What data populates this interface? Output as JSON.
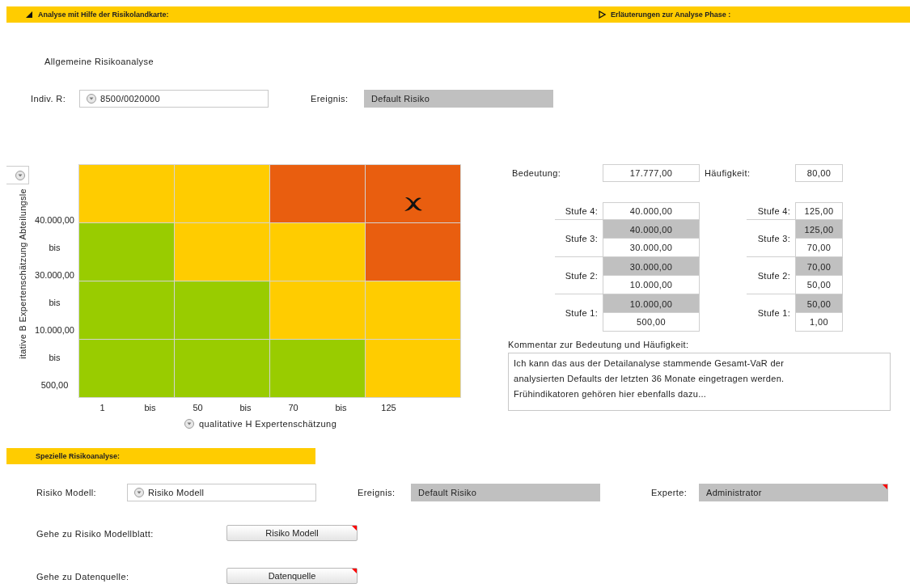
{
  "header": {
    "title": "Analyse mit Hilfe der Risikolandkarte:",
    "expanded": true,
    "explanation": {
      "label": "Erläuterungen zur Analyse Phase :",
      "expanded": false
    }
  },
  "general": {
    "title": "Allgemeine Risikoanalyse",
    "indiv_label": "Indiv. R:",
    "indiv_value": "8500/0020000",
    "event_label": "Ereignis:",
    "event_value": "Default Risiko"
  },
  "matrix": {
    "y_axis_title": "itative B Expertenschätzung Abteilungsle",
    "y_labels": [
      "40.000,00",
      "bis",
      "30.000,00",
      "bis",
      "10.000,00",
      "bis",
      "500,00"
    ],
    "x_labels": [
      "1",
      "bis",
      "50",
      "bis",
      "70",
      "bis",
      "125"
    ],
    "x_axis_title": "qualitative H Expertenschätzung",
    "rows": [
      [
        {
          "color": "#ffcc00",
          "marked": false
        },
        {
          "color": "#ffcc00",
          "marked": false
        },
        {
          "color": "#e95e0f",
          "marked": false
        },
        {
          "color": "#e95e0f",
          "marked": true
        }
      ],
      [
        {
          "color": "#99cc00",
          "marked": false
        },
        {
          "color": "#ffcc00",
          "marked": false
        },
        {
          "color": "#ffcc00",
          "marked": false
        },
        {
          "color": "#e95e0f",
          "marked": false
        }
      ],
      [
        {
          "color": "#99cc00",
          "marked": false
        },
        {
          "color": "#99cc00",
          "marked": false
        },
        {
          "color": "#ffcc00",
          "marked": false
        },
        {
          "color": "#ffcc00",
          "marked": false
        }
      ],
      [
        {
          "color": "#99cc00",
          "marked": false
        },
        {
          "color": "#99cc00",
          "marked": false
        },
        {
          "color": "#99cc00",
          "marked": false
        },
        {
          "color": "#ffcc00",
          "marked": false
        }
      ]
    ]
  },
  "assessment": {
    "significance_label": "Bedeutung:",
    "significance_value": "17.777,00",
    "frequency_label": "Häufigkeit:",
    "frequency_value": "80,00",
    "significance_levels": [
      {
        "label": "Stufe 4:",
        "values": [
          {
            "text": "40.000,00",
            "shaded": false
          }
        ]
      },
      {
        "label": "Stufe 3:",
        "values": [
          {
            "text": "40.000,00",
            "shaded": true
          },
          {
            "text": "30.000,00",
            "shaded": false
          }
        ]
      },
      {
        "label": "Stufe 2:",
        "values": [
          {
            "text": "30.000,00",
            "shaded": true
          },
          {
            "text": "10.000,00",
            "shaded": false
          }
        ]
      },
      {
        "label": "Stufe 1:",
        "values": [
          {
            "text": "10.000,00",
            "shaded": true
          },
          {
            "text": "500,00",
            "shaded": false
          }
        ]
      }
    ],
    "frequency_levels": [
      {
        "label": "Stufe 4:",
        "values": [
          {
            "text": "125,00",
            "shaded": false
          }
        ]
      },
      {
        "label": "Stufe 3:",
        "values": [
          {
            "text": "125,00",
            "shaded": true
          },
          {
            "text": "70,00",
            "shaded": false
          }
        ]
      },
      {
        "label": "Stufe 2:",
        "values": [
          {
            "text": "70,00",
            "shaded": true
          },
          {
            "text": "50,00",
            "shaded": false
          }
        ]
      },
      {
        "label": "Stufe 1:",
        "values": [
          {
            "text": "50,00",
            "shaded": true
          },
          {
            "text": "1,00",
            "shaded": false
          }
        ]
      }
    ],
    "comment_label": "Kommentar zur Bedeutung und Häufigkeit:",
    "comment_lines": [
      "Ich kann das aus der Detailanalyse stammende Gesamt-VaR der",
      "analysierten Defaults der letzten 36 Monate eingetragen werden.",
      "Frühindikatoren gehören hier ebenfalls dazu..."
    ]
  },
  "special": {
    "title": "Spezielle Risikoanalyse:",
    "model_label": "Risiko Modell:",
    "model_value": "Risiko Modell",
    "event_label": "Ereignis:",
    "event_value": "Default Risiko",
    "expert_label": "Experte:",
    "expert_value": "Administrator",
    "expert_has_comment": true,
    "links": [
      {
        "label": "Gehe zu Risiko Modellblatt:",
        "button": "Risiko Modell",
        "has_comment": true
      },
      {
        "label": "Gehe zu Datenquelle:",
        "button": "Datenquelle",
        "has_comment": true
      }
    ]
  }
}
